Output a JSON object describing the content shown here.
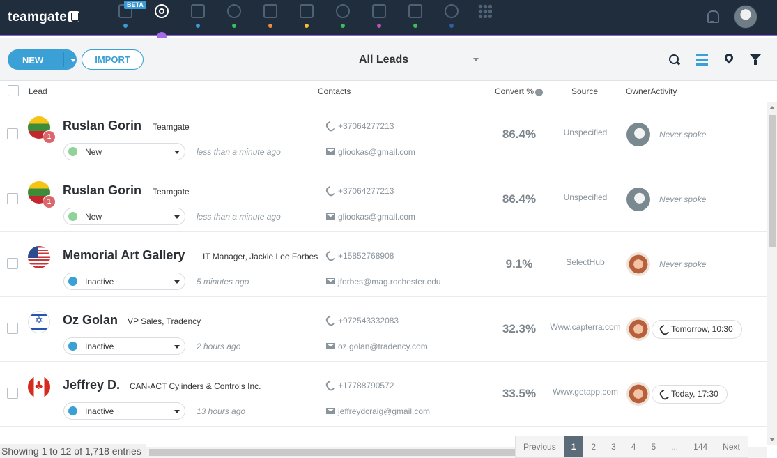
{
  "app": {
    "logo_text": "teamgate",
    "beta_badge": "BETA"
  },
  "nav": {
    "items": [
      {
        "name": "nav-dashboard",
        "dot_color": "#3b9bd6"
      },
      {
        "name": "nav-leads",
        "dot_color": "#a76be8",
        "active": true
      },
      {
        "name": "nav-companies",
        "dot_color": "#3b9bd6"
      },
      {
        "name": "nav-contacts",
        "dot_color": "#3bbf5a"
      },
      {
        "name": "nav-deals",
        "dot_color": "#f08a3c"
      },
      {
        "name": "nav-calendar",
        "dot_color": "#f2c12e"
      },
      {
        "name": "nav-conversations",
        "dot_color": "#3bbf5a"
      },
      {
        "name": "nav-inbox",
        "dot_color": "#c04fb8"
      },
      {
        "name": "nav-files",
        "dot_color": "#3bbf5a"
      },
      {
        "name": "nav-reports",
        "dot_color": "#2e5fa8"
      }
    ]
  },
  "toolbar": {
    "new_label": "NEW",
    "import_label": "IMPORT",
    "view_title": "All Leads"
  },
  "table": {
    "headers": {
      "lead": "Lead",
      "contacts": "Contacts",
      "convert": "Convert %",
      "source": "Source",
      "owner_activity": "OwnerActivity"
    },
    "rows": [
      {
        "name": "Ruslan Gorin",
        "company": "Teamgate",
        "flag": "lt",
        "badge": "1",
        "status": "New",
        "status_color": "#8fd29a",
        "time": "less than a minute ago",
        "phone": "+37064277213",
        "email": "gliookas@gmail.com",
        "convert": "86.4%",
        "source": "Unspecified",
        "owner": "dog",
        "activity": "Never spoke",
        "activity_type": "text"
      },
      {
        "name": "Ruslan Gorin",
        "company": "Teamgate",
        "flag": "lt",
        "badge": "1",
        "status": "New",
        "status_color": "#8fd29a",
        "time": "less than a minute ago",
        "phone": "+37064277213",
        "email": "gliookas@gmail.com",
        "convert": "86.4%",
        "source": "Unspecified",
        "owner": "dog",
        "activity": "Never spoke",
        "activity_type": "text"
      },
      {
        "name": "Memorial Art Gallery",
        "company": "IT Manager, Jackie Lee Forbes",
        "flag": "us",
        "badge": "",
        "status": "Inactive",
        "status_color": "#3aa0d6",
        "time": "5 minutes ago",
        "phone": "+15852768908",
        "email": "jforbes@mag.rochester.edu",
        "convert": "9.1%",
        "source": "SelectHub",
        "owner": "woman",
        "activity": "Never spoke",
        "activity_type": "text"
      },
      {
        "name": "Oz Golan",
        "company": "VP Sales, Tradency",
        "flag": "il",
        "badge": "",
        "status": "Inactive",
        "status_color": "#3aa0d6",
        "time": "2 hours ago",
        "phone": "+972543332083",
        "email": "oz.golan@tradency.com",
        "convert": "32.3%",
        "source": "Www.capterra.com",
        "owner": "woman",
        "activity": "Tomorrow, 10:30",
        "activity_type": "call"
      },
      {
        "name": "Jeffrey D.",
        "company": "CAN-ACT Cylinders & Controls Inc.",
        "flag": "ca",
        "badge": "",
        "status": "Inactive",
        "status_color": "#3aa0d6",
        "time": "13 hours ago",
        "phone": "+17788790572",
        "email": "jeffreydcraig@gmail.com",
        "convert": "33.5%",
        "source": "Www.getapp.com",
        "owner": "woman",
        "activity": "Today, 17:30",
        "activity_type": "call"
      }
    ]
  },
  "footer": {
    "showing": "Showing 1 to 12 of 1,718 entries",
    "pages": [
      "Previous",
      "1",
      "2",
      "3",
      "4",
      "5",
      "...",
      "144",
      "Next"
    ],
    "current_page": "1"
  }
}
